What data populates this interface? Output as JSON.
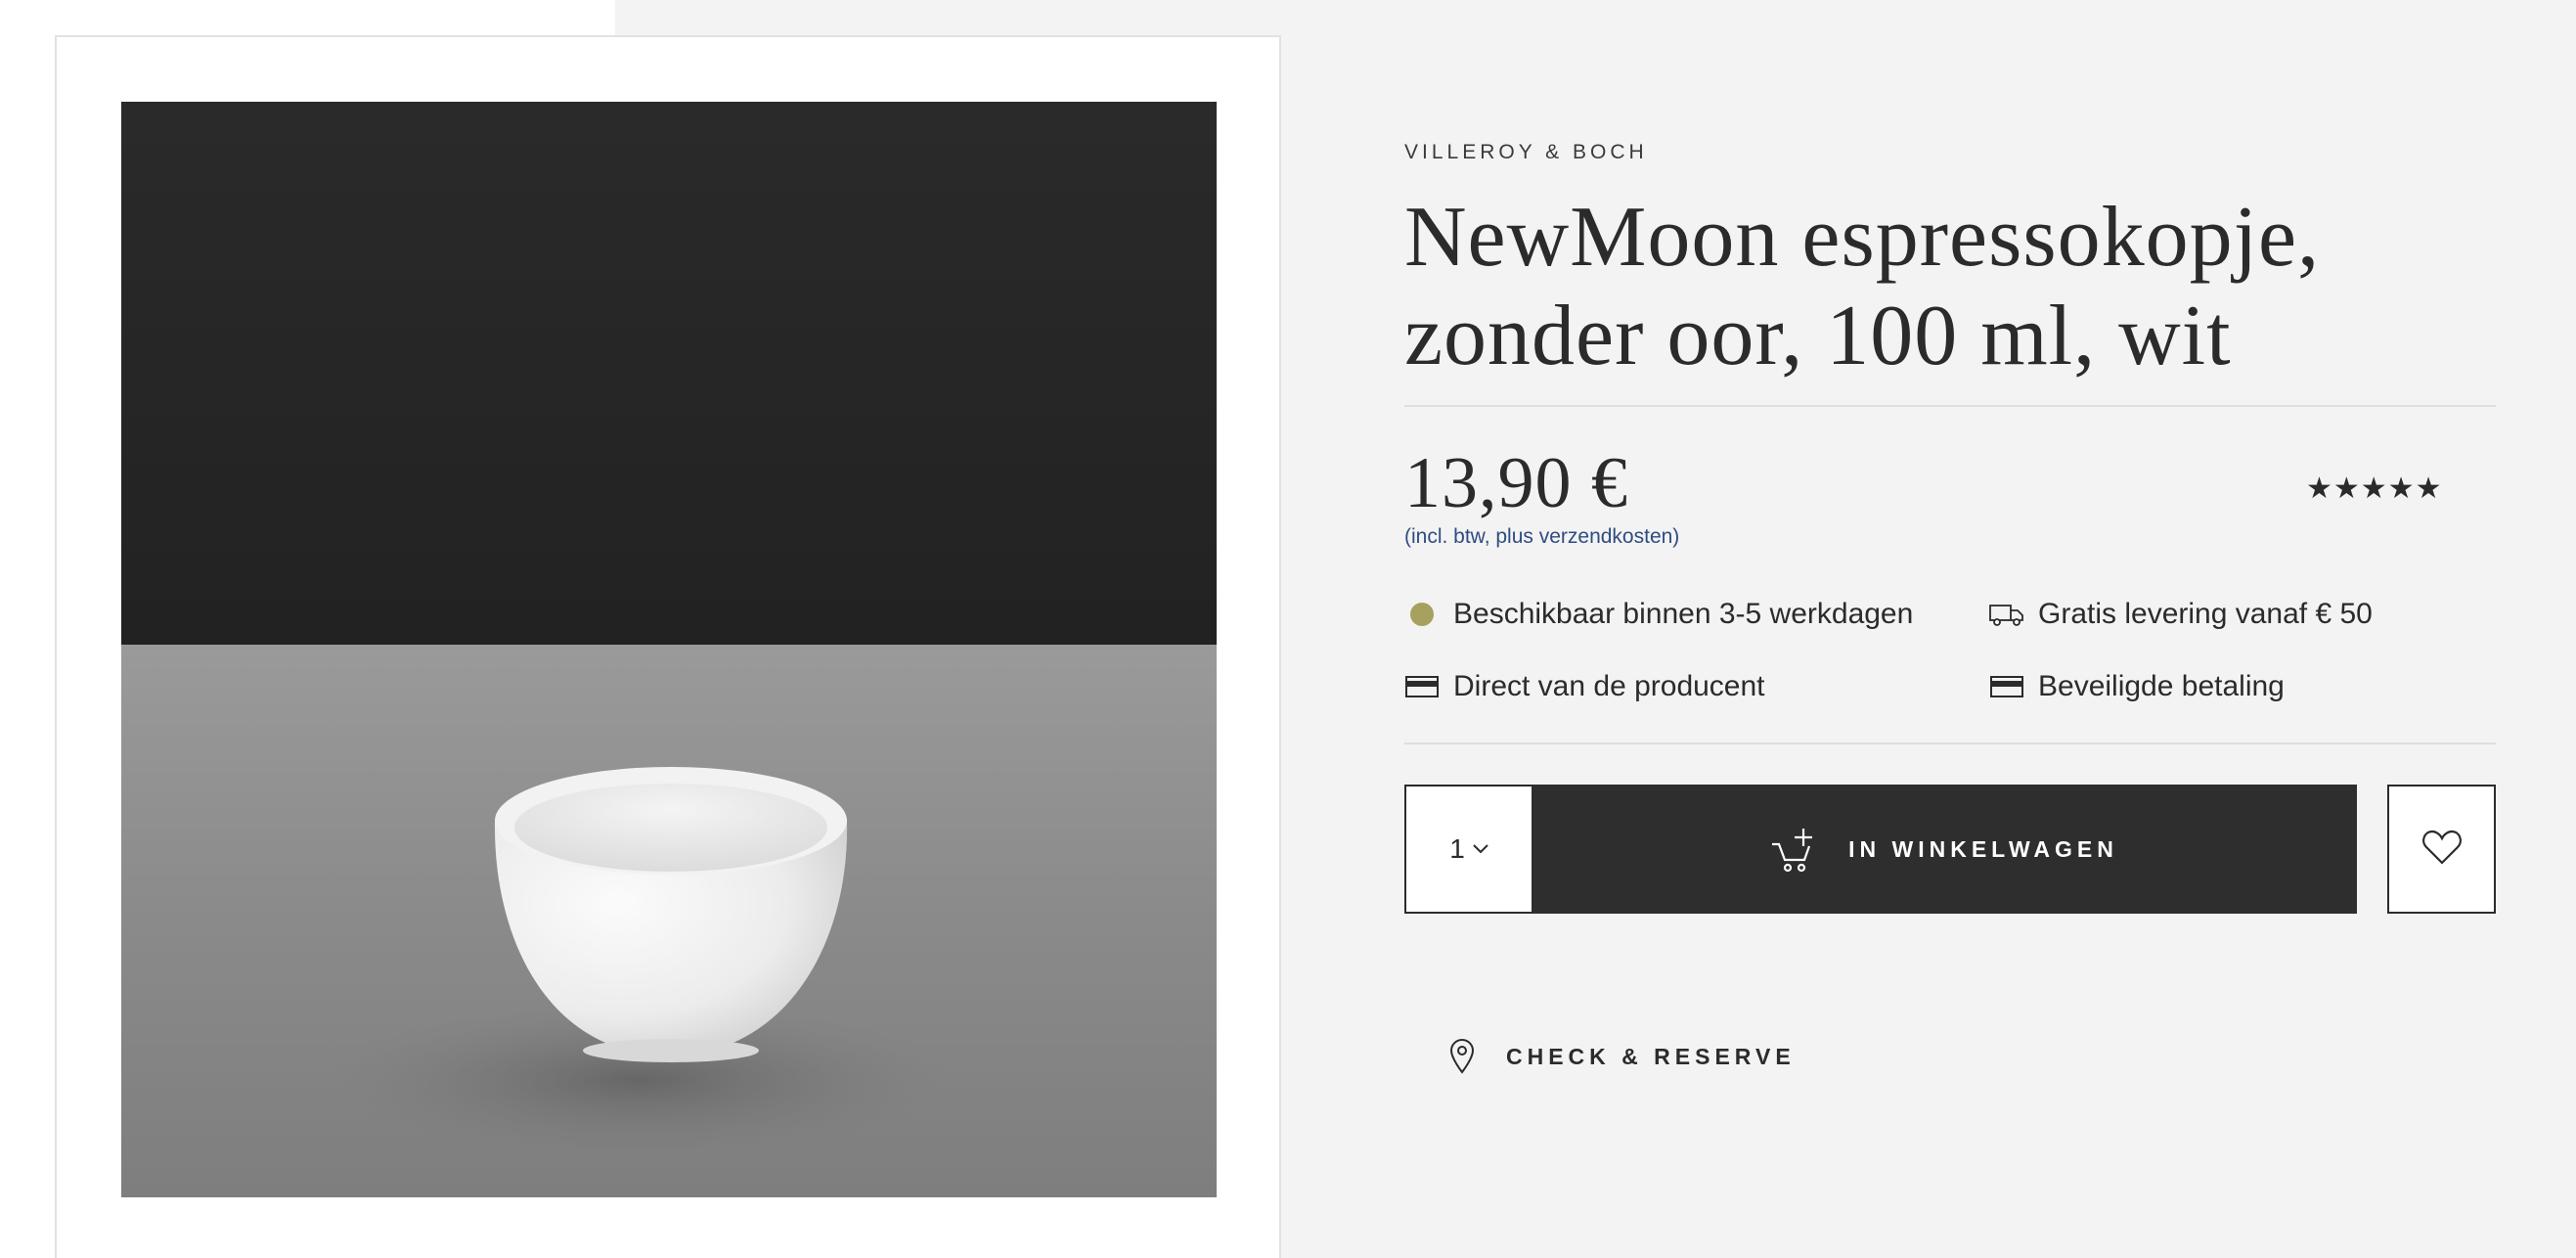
{
  "product": {
    "brand": "VILLEROY & BOCH",
    "title_line1": "NewMoon espressokopje,",
    "title_line2": "zonder oor, 100 ml, wit",
    "image_icon": "espresso-cup-photo"
  },
  "pricing": {
    "price": "13,90 €",
    "vat_note": "(incl. btw, plus verzendkosten)",
    "rating_stars": "★★★★★",
    "rating_value": 5
  },
  "features": {
    "availability": "Beschikbaar binnen 3-5 werkdagen",
    "shipping": "Gratis levering vanaf € 50",
    "direct": "Direct van de producent",
    "secure": "Beveiligde betaling"
  },
  "purchase": {
    "quantity": "1",
    "add_to_cart": "IN WINKELWAGEN",
    "reserve": "CHECK & RESERVE"
  },
  "colors": {
    "background": "#f3f3f3",
    "text": "#2b2b2b",
    "button": "#2e2e2e",
    "availability_dot": "#a6a15e",
    "link": "#2f4c82"
  }
}
